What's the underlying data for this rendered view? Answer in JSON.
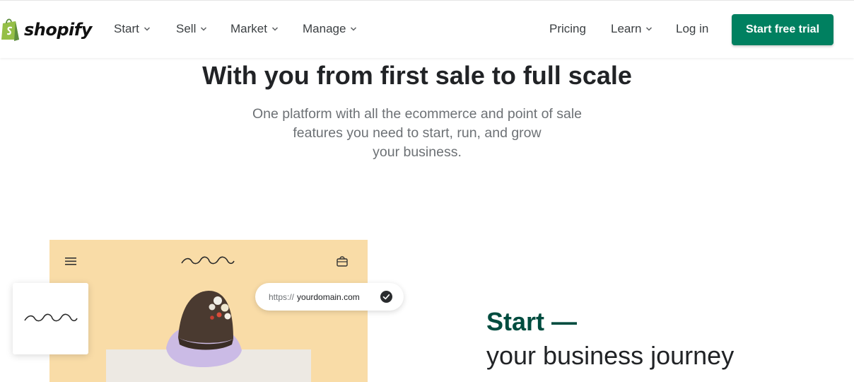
{
  "brand": {
    "name": "shopify",
    "color": "#95bf47"
  },
  "nav": {
    "start": "Start",
    "sell": "Sell",
    "market": "Market",
    "manage": "Manage",
    "pricing": "Pricing",
    "learn": "Learn",
    "login": "Log in",
    "cta": "Start free trial"
  },
  "hero": {
    "title": "With you from first sale to full scale",
    "subtitle_line1": "One platform with all the ecommerce and point of sale",
    "subtitle_line2": "features you need to start, run, and grow",
    "subtitle_line3": "your business."
  },
  "illustration": {
    "url_protocol": "https://",
    "url_domain": "yourdomain.com"
  },
  "section": {
    "title": "Start",
    "dash": "—",
    "subtitle": "your business journey"
  },
  "colors": {
    "accent": "#008060",
    "dark_green": "#004c3f",
    "store_bg": "#f9dca7"
  }
}
